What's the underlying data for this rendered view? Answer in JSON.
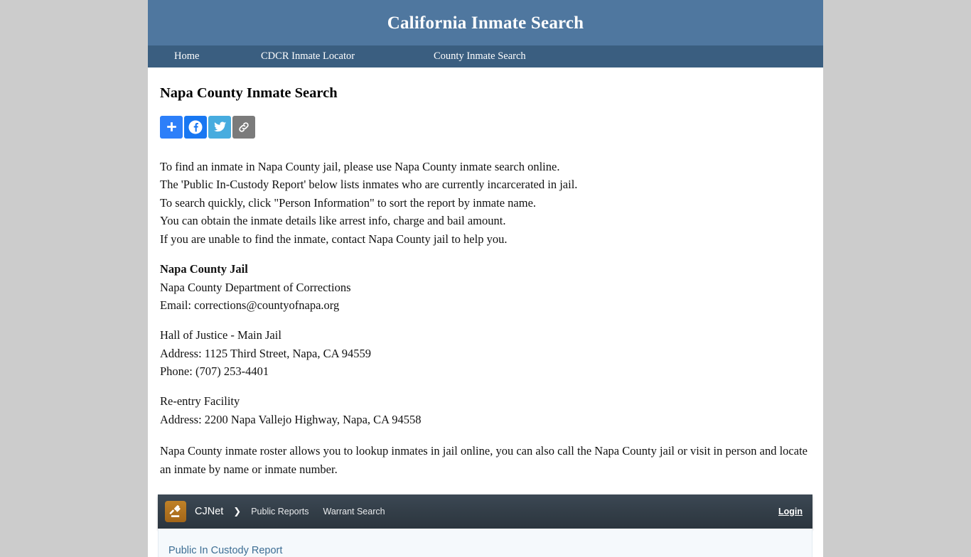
{
  "site": {
    "title": "California Inmate Search",
    "nav": [
      {
        "label": "Home",
        "name": "nav-home"
      },
      {
        "label": "CDCR Inmate Locator",
        "name": "nav-cdcr-inmate-locator"
      },
      {
        "label": "County Inmate Search",
        "name": "nav-county-inmate-search"
      }
    ],
    "colors": {
      "header_bg": "#4f779f",
      "nav_bg": "#3a5e80",
      "page_bg": "#cccccc",
      "container_bg": "#ffffff"
    }
  },
  "main": {
    "page_title": "Napa County Inmate Search",
    "share_buttons": [
      {
        "icon": "share-plus-icon",
        "label": "Share",
        "color": "#2d7ff9"
      },
      {
        "icon": "facebook-icon",
        "label": "Facebook",
        "color": "#1877f2"
      },
      {
        "icon": "twitter-icon",
        "label": "Twitter",
        "color": "#47acdf"
      },
      {
        "icon": "copy-link-icon",
        "label": "Copy Link",
        "color": "#7b7b7b"
      }
    ],
    "intro_lines": [
      "To find an inmate in Napa County jail, please use Napa County inmate search online.",
      "The 'Public In-Custody Report' below lists inmates who are currently incarcerated in jail.",
      "To search quickly, click \"Person Information\" to sort the report by inmate name.",
      "You can obtain the inmate details like arrest info, charge and bail amount.",
      "If you are unable to find the inmate, contact Napa County jail to help you."
    ],
    "jail": {
      "heading": "Napa County Jail",
      "department": "Napa County Department of Corrections",
      "email": "Email: corrections@countyofnapa.org"
    },
    "main_jail": {
      "name": "Hall of Justice - Main Jail",
      "address": "Address: 1125 Third Street, Napa, CA 94559",
      "phone": "Phone: (707) 253-4401"
    },
    "reentry": {
      "name": "Re-entry Facility",
      "address": "Address: 2200 Napa Vallejo Highway, Napa, CA 94558"
    },
    "closing_paragraph": "Napa County inmate roster allows you to lookup inmates in jail online, you can also call the Napa County jail or visit in person and locate an inmate by name or inmate number."
  },
  "cjnet": {
    "logo_icon": "gavel-icon",
    "brand": "CJNet",
    "chevron": "❯",
    "breadcrumbs": [
      {
        "label": "Public Reports",
        "name": "cjnet-crumb-public-reports"
      },
      {
        "label": "Warrant Search",
        "name": "cjnet-crumb-warrant-search"
      }
    ],
    "login_label": "Login",
    "panel_title": "Public In Custody Report",
    "colors": {
      "bar_bg": "#333e48",
      "logo_bg": "#b4761f",
      "panel_bg": "#f5f9fc",
      "panel_title_color": "#3d6e94"
    }
  }
}
